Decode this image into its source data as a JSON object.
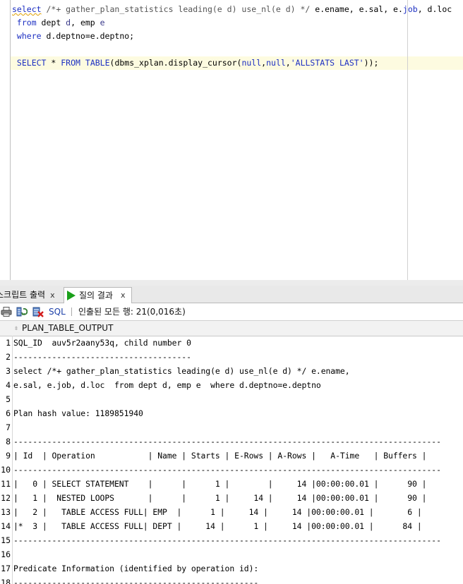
{
  "editor": {
    "lines": [
      {
        "parts": [
          {
            "t": "select",
            "c": "kw squig"
          },
          {
            "t": " ",
            "c": ""
          },
          {
            "t": "/*+ gather_plan_statistics leading(e d) use_nl(e d) */",
            "c": "cm"
          },
          {
            "t": " e.ename, e.sal, e.",
            "c": ""
          },
          {
            "t": "job",
            "c": "kw"
          },
          {
            "t": ", d.loc",
            "c": ""
          }
        ]
      },
      {
        "parts": [
          {
            "t": " from",
            "c": "kw"
          },
          {
            "t": " dept ",
            "c": ""
          },
          {
            "t": "d",
            "c": "dim"
          },
          {
            "t": ", emp ",
            "c": ""
          },
          {
            "t": "e",
            "c": "dim"
          }
        ]
      },
      {
        "parts": [
          {
            "t": " where",
            "c": "kw"
          },
          {
            "t": " d.deptno=e.deptno;",
            "c": ""
          }
        ]
      },
      {
        "parts": []
      },
      {
        "parts": [
          {
            "t": " SELECT",
            "c": "kw"
          },
          {
            "t": " * ",
            "c": ""
          },
          {
            "t": "FROM",
            "c": "kw"
          },
          {
            "t": " ",
            "c": ""
          },
          {
            "t": "TABLE",
            "c": "kw"
          },
          {
            "t": "(dbms_xplan.display_cursor(",
            "c": ""
          },
          {
            "t": "null",
            "c": "kw"
          },
          {
            "t": ",",
            "c": ""
          },
          {
            "t": "null",
            "c": "kw"
          },
          {
            "t": ",",
            "c": ""
          },
          {
            "t": "'ALLSTATS LAST'",
            "c": "str"
          },
          {
            "t": "));",
            "c": ""
          }
        ]
      }
    ]
  },
  "tabs": {
    "script_output": {
      "label": "스크립트 출력",
      "close": "x"
    },
    "query_result": {
      "label": "질의 결과",
      "close": "x"
    }
  },
  "toolbar": {
    "sql_label": "SQL",
    "status": "인출된 모든 행: 21(0,016초)"
  },
  "grid": {
    "column_header": "PLAN_TABLE_OUTPUT",
    "rows": [
      {
        "n": "1",
        "text": "SQL_ID  auv5r2aany53q, child number 0"
      },
      {
        "n": "2",
        "text": "-------------------------------------"
      },
      {
        "n": "3",
        "text": "select /*+ gather_plan_statistics leading(e d) use_nl(e d) */ e.ename,"
      },
      {
        "n": "4",
        "text": "e.sal, e.job, d.loc  from dept d, emp e  where d.deptno=e.deptno"
      },
      {
        "n": "5",
        "text": ""
      },
      {
        "n": "6",
        "text": "Plan hash value: 1189851940"
      },
      {
        "n": "7",
        "text": ""
      },
      {
        "n": "8",
        "text": "-----------------------------------------------------------------------------------------"
      },
      {
        "n": "9",
        "text": "| Id  | Operation           | Name | Starts | E-Rows | A-Rows |   A-Time   | Buffers |"
      },
      {
        "n": "10",
        "text": "-----------------------------------------------------------------------------------------"
      },
      {
        "n": "11",
        "text": "|   0 | SELECT STATEMENT    |      |      1 |        |     14 |00:00:00.01 |      90 |"
      },
      {
        "n": "12",
        "text": "|   1 |  NESTED LOOPS       |      |      1 |     14 |     14 |00:00:00.01 |      90 |"
      },
      {
        "n": "13",
        "text": "|   2 |   TABLE ACCESS FULL| EMP  |      1 |     14 |     14 |00:00:00.01 |       6 |"
      },
      {
        "n": "14",
        "text": "|*  3 |   TABLE ACCESS FULL| DEPT |     14 |      1 |     14 |00:00:00.01 |      84 |"
      },
      {
        "n": "15",
        "text": "-----------------------------------------------------------------------------------------"
      },
      {
        "n": "16",
        "text": ""
      },
      {
        "n": "17",
        "text": "Predicate Information (identified by operation id):"
      },
      {
        "n": "18",
        "text": "---------------------------------------------------"
      }
    ]
  },
  "colors": {
    "keyword": "#1c2fc2",
    "run_icon": "#1aa01a"
  }
}
